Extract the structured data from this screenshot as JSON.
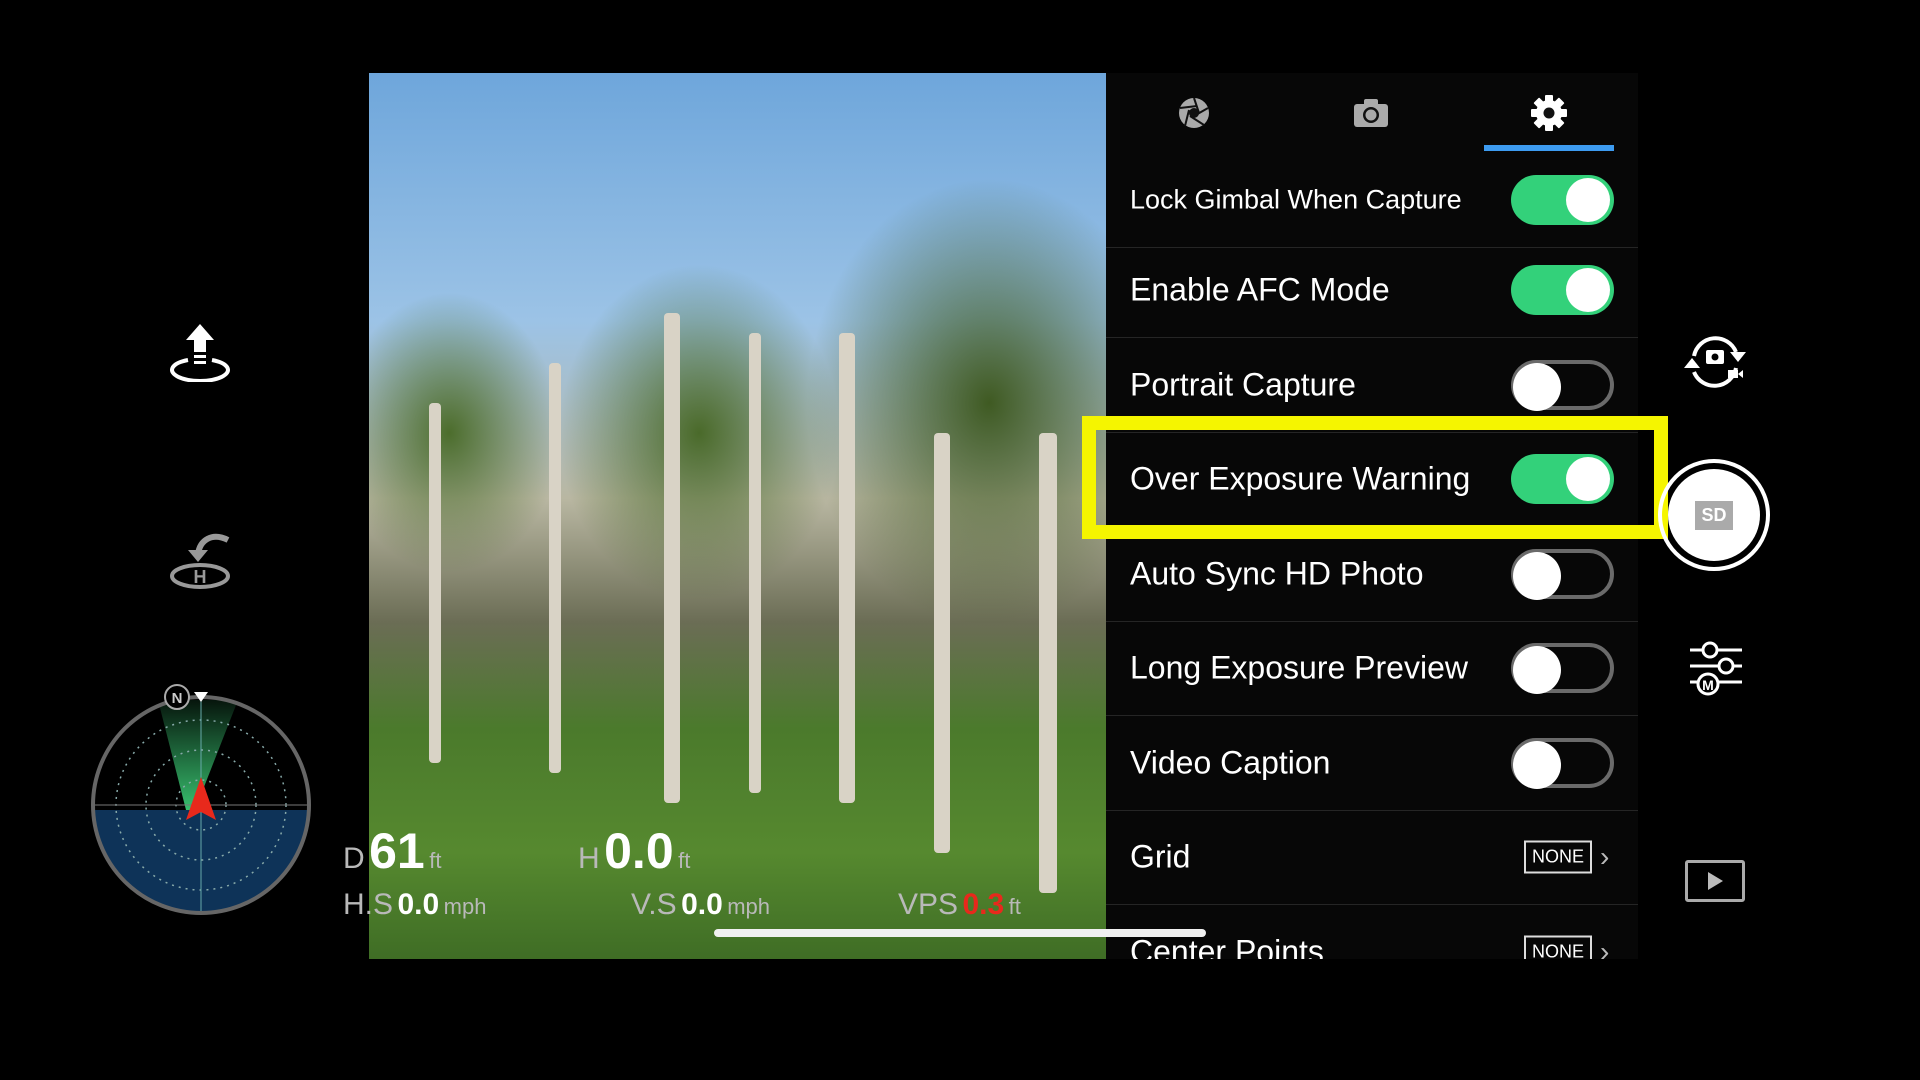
{
  "colors": {
    "accent_blue": "#3d9bf0",
    "toggle_on": "#33d17a",
    "highlight": "#f5f500",
    "warning_red": "#e8291c"
  },
  "left_controls": {
    "takeoff_icon": "takeoff-icon",
    "return_home_icon": "return-home-icon"
  },
  "radar": {
    "north_label": "N"
  },
  "telemetry": {
    "distance": {
      "key": "D",
      "value": "61",
      "unit": "ft"
    },
    "height": {
      "key": "H",
      "value": "0.0",
      "unit": "ft"
    },
    "horizontal_speed": {
      "key": "H.S",
      "value": "0.0",
      "unit": "mph"
    },
    "vertical_speed": {
      "key": "V.S",
      "value": "0.0",
      "unit": "mph"
    },
    "vps": {
      "key": "VPS",
      "value": "0.3",
      "unit": "ft"
    }
  },
  "settings_panel": {
    "tabs": [
      {
        "icon": "aperture-icon",
        "active": false
      },
      {
        "icon": "camera-icon",
        "active": true
      },
      {
        "icon": "gear-icon",
        "active": true
      }
    ],
    "rows": [
      {
        "label": "Lock Gimbal When Capture",
        "type": "toggle",
        "on": true
      },
      {
        "label": "Enable AFC Mode",
        "type": "toggle",
        "on": true
      },
      {
        "label": "Portrait Capture",
        "type": "toggle",
        "on": false
      },
      {
        "label": "Over Exposure Warning",
        "type": "toggle",
        "on": true,
        "highlighted": true
      },
      {
        "label": "Auto Sync HD Photo",
        "type": "toggle",
        "on": false
      },
      {
        "label": "Long Exposure Preview",
        "type": "toggle",
        "on": false
      },
      {
        "label": "Video Caption",
        "type": "toggle",
        "on": false
      },
      {
        "label": "Grid",
        "type": "select",
        "value": "NONE"
      },
      {
        "label": "Center Points",
        "type": "select",
        "value": "NONE"
      }
    ]
  },
  "right_controls": {
    "shutter_badge": "SD",
    "icons": [
      "switch-photo-video-icon",
      "shutter-no-sd-icon",
      "manual-settings-icon",
      "playback-icon"
    ]
  }
}
